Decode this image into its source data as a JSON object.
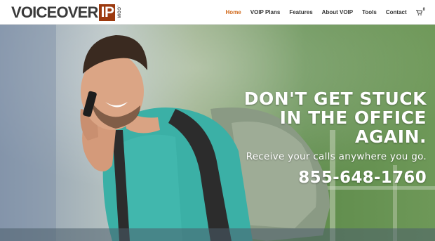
{
  "logo": {
    "voiceover": "VOICEOVER",
    "ip": "IP",
    "com": ".COM"
  },
  "nav": {
    "items": [
      {
        "label": "Home",
        "active": true
      },
      {
        "label": "VOIP Plans",
        "active": false
      },
      {
        "label": "Features",
        "active": false
      },
      {
        "label": "About VOIP",
        "active": false
      },
      {
        "label": "Tools",
        "active": false
      },
      {
        "label": "Contact",
        "active": false
      }
    ],
    "cart_icon": "shopping-cart-icon",
    "cart_count": "0"
  },
  "hero": {
    "headline_lines": [
      "DON'T GET STUCK",
      "IN THE OFFICE",
      "AGAIN."
    ],
    "subline": "Receive your calls anywhere you go.",
    "phone": "855-648-1760"
  },
  "colors": {
    "brand": "#9c3a0f",
    "nav_active": "#d06a1d",
    "nav_text": "#333333",
    "hero_text": "#ffffff"
  }
}
